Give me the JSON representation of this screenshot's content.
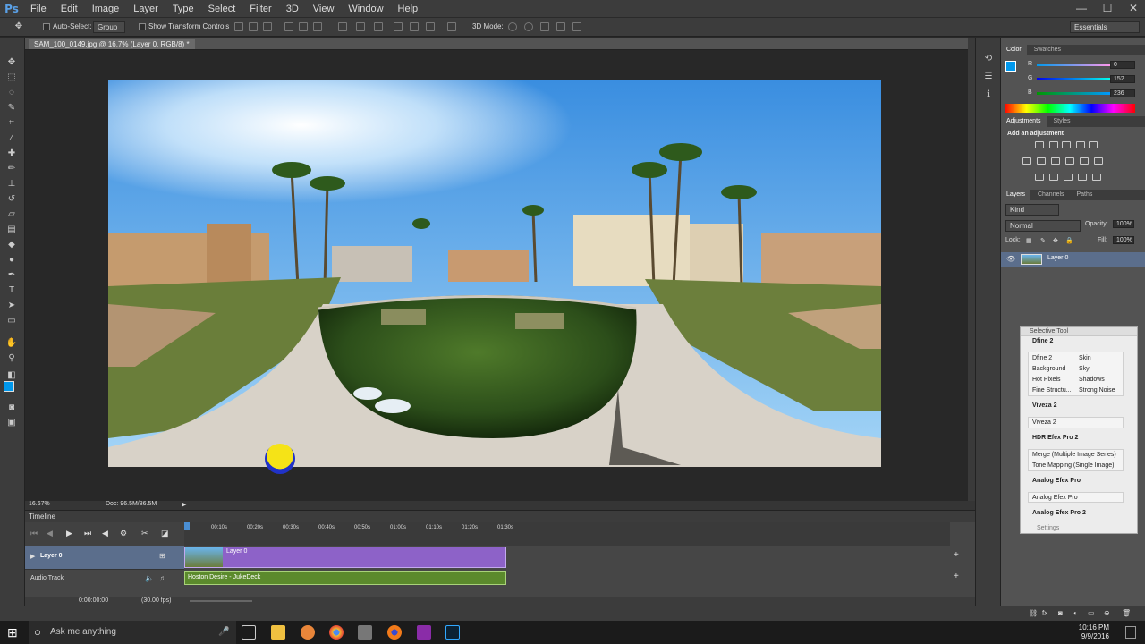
{
  "app": {
    "logo": "Ps"
  },
  "menu": [
    "File",
    "Edit",
    "Image",
    "Layer",
    "Type",
    "Select",
    "Filter",
    "3D",
    "View",
    "Window",
    "Help"
  ],
  "window_controls": {
    "minimize": "—",
    "maximize": "☐",
    "close": "✕"
  },
  "options": {
    "auto_select_label": "Auto-Select:",
    "auto_select_value": "Group",
    "show_transform_label": "Show Transform Controls",
    "mode_3d_label": "3D Mode:",
    "workspace": "Essentials"
  },
  "document": {
    "tab": "SAM_100_0149.jpg @ 16.7% (Layer 0, RGB/8) *"
  },
  "status": {
    "zoom": "16.67%",
    "doc": "Doc: 96.5M/86.5M"
  },
  "timeline": {
    "title": "Timeline",
    "ticks": [
      "00:10s",
      "00:20s",
      "00:30s",
      "00:40s",
      "00:50s",
      "01:00s",
      "01:10s",
      "01:20s",
      "01:30s"
    ],
    "layer_track": "Layer 0",
    "audio_track": "Audio Track",
    "clip_label": "Layer 0",
    "audio_clip": "Hoston Desire - JukeDeck",
    "timecode": "0:00:00:00",
    "fps": "(30.00 fps)"
  },
  "color_panel": {
    "tabs": [
      "Color",
      "Swatches"
    ],
    "r_label": "R",
    "g_label": "G",
    "b_label": "B",
    "r": "0",
    "g": "152",
    "b": "236",
    "fg_color": "#0098ec"
  },
  "adjustments": {
    "tabs": [
      "Adjustments",
      "Styles"
    ],
    "add_label": "Add an adjustment"
  },
  "layers_panel": {
    "tabs": [
      "Layers",
      "Channels",
      "Paths"
    ],
    "kind": "Kind",
    "blend_mode": "Normal",
    "opacity_label": "Opacity:",
    "opacity": "100%",
    "lock_label": "Lock:",
    "fill_label": "Fill:",
    "fill": "100%",
    "layer_name": "Layer 0"
  },
  "selective_tool": {
    "title": "Selective Tool",
    "dfine_head": "Dfine 2",
    "dfine_items": [
      "Dfine 2",
      "Skin",
      "Background",
      "Sky",
      "Hot Pixels",
      "Shadows",
      "Fine Structu...",
      "Strong Noise"
    ],
    "viveza_head": "Viveza 2",
    "viveza_item": "Viveza 2",
    "hdr_head": "HDR Efex Pro 2",
    "hdr_items": [
      "Merge (Multiple Image Series)",
      "Tone Mapping (Single Image)"
    ],
    "analog_head": "Analog Efex Pro",
    "analog_item": "Analog Efex Pro",
    "analog2_head": "Analog Efex Pro 2",
    "settings": "Settings"
  },
  "taskbar": {
    "search_placeholder": "Ask me anything",
    "time": "10:16 PM",
    "date": "9/9/2016"
  }
}
